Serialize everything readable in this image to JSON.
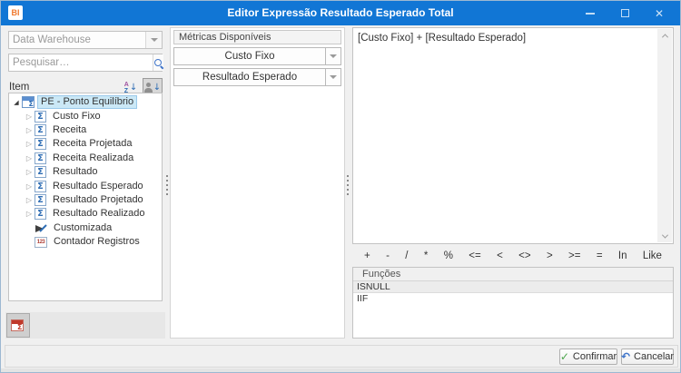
{
  "window": {
    "title": "Editor Expressão Resultado Esperado Total",
    "logo": "BI"
  },
  "icons": {
    "close": "✕",
    "check": "✓",
    "undo": "↶",
    "sigma": "Σ",
    "expanded": "◢",
    "collapsed": "▷",
    "counter": "123",
    "sort_a": "A",
    "sort_z": "Z",
    "arrow_down": "↓"
  },
  "left_panel": {
    "source_combo": {
      "value": "Data Warehouse"
    },
    "search": {
      "placeholder": "Pesquisar…"
    },
    "items_label": "Item",
    "tree": {
      "root_label": "PE - Ponto Equilíbrio",
      "metrics": [
        "Custo Fixo",
        "Receita",
        "Receita Projetada",
        "Receita Realizada",
        "Resultado",
        "Resultado Esperado",
        "Resultado Projetado",
        "Resultado Realizado"
      ],
      "customizada": "Customizada",
      "contador": "Contador Registros"
    }
  },
  "metrics_panel": {
    "header": "Métricas Disponíveis",
    "button1": "Custo Fixo",
    "button2": "Resultado Esperado"
  },
  "expression_panel": {
    "expression": "[Custo Fixo] + [Resultado Esperado]",
    "operators": [
      "+",
      "-",
      "/",
      "*",
      "%",
      "<=",
      "<",
      "<>",
      ">",
      ">=",
      "=",
      "In",
      "Like"
    ],
    "functions_header": "Funções",
    "functions": [
      "ISNULL",
      "IIF"
    ]
  },
  "footer": {
    "confirm_label": "Confirmar",
    "cancel_label": "Cancelar"
  },
  "colors": {
    "titlebar": "#1176d5",
    "selection_bg": "#cbe8f6",
    "sigma_blue": "#2e6db4",
    "logo_orange": "#f0792f",
    "confirm_green": "#4ca64c",
    "undo_blue": "#3f74c9"
  }
}
